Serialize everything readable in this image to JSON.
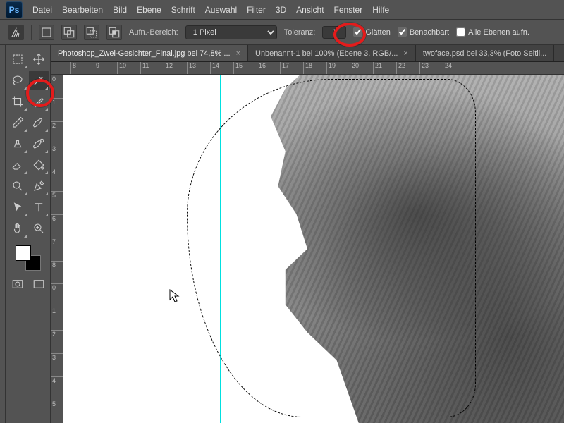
{
  "app": {
    "logo": "Ps"
  },
  "menu": [
    "Datei",
    "Bearbeiten",
    "Bild",
    "Ebene",
    "Schrift",
    "Auswahl",
    "Filter",
    "3D",
    "Ansicht",
    "Fenster",
    "Hilfe"
  ],
  "options": {
    "aufn_bereich_label": "Aufn.-Bereich:",
    "aufn_bereich_value": "1 Pixel",
    "aufn_bereich_options": [
      "1 Pixel"
    ],
    "toleranz_label": "Toleranz:",
    "toleranz_value": "1",
    "glaetten_label": "Glätten",
    "glaetten_checked": true,
    "benachbart_label": "Benachbart",
    "benachbart_checked": true,
    "alle_ebenen_label": "Alle Ebenen aufn.",
    "alle_ebenen_checked": false
  },
  "tabs": [
    {
      "label": "Photoshop_Zwei-Gesichter_Final.jpg bei 74,8% ...",
      "active": true
    },
    {
      "label": "Unbenannt-1 bei 100% (Ebene 3, RGB/...",
      "active": false
    },
    {
      "label": "twoface.psd bei 33,3% (Foto Seitli...",
      "active": false
    }
  ],
  "ruler_h": [
    "8",
    "9",
    "10",
    "11",
    "12",
    "13",
    "14",
    "15",
    "16",
    "17",
    "18",
    "19",
    "20",
    "21",
    "22",
    "23",
    "24"
  ],
  "ruler_v": [
    "0",
    "1",
    "2",
    "3",
    "4",
    "5",
    "6",
    "7",
    "8",
    "0",
    "1",
    "2",
    "3",
    "4",
    "5"
  ],
  "tools_left": [
    "move",
    "marquee",
    "lasso",
    "magic-wand",
    "crop",
    "slice",
    "eyedropper",
    "brush",
    "clone",
    "history-brush",
    "eraser",
    "paint-bucket",
    "dodge",
    "pen",
    "pointer",
    "type",
    "hand",
    "zoom"
  ],
  "swatch": {
    "fg": "#ffffff",
    "bg": "#000000"
  },
  "highlights": {
    "tool": "magic-wand",
    "option": "toleranz"
  }
}
